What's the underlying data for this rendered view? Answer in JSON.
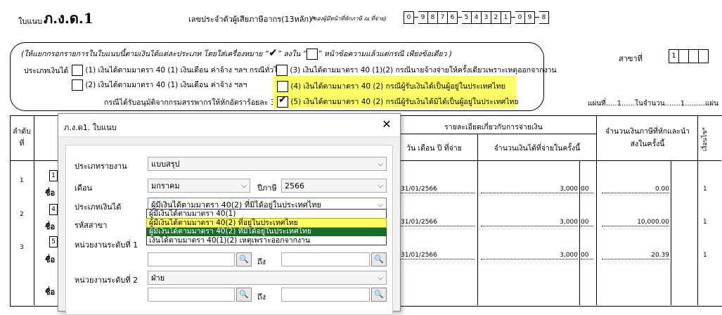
{
  "form": {
    "title_prefix": "ใบแนบ",
    "title": "ภ.ง.ด.1",
    "taxid_label": "เลขประจำตัวผู้เสียภาษีอากร(13หลัก)*",
    "taxid_note": "(ของผู้มีหน้าที่หักภาษี ณ ที่จ่าย)",
    "taxid_digits": [
      "0",
      "9",
      "8",
      "7",
      "6",
      "5",
      "4",
      "3",
      "2",
      "1",
      "0",
      "9",
      "8"
    ],
    "instruction": "(ให้แยกกรอกรายการในใบแนบนี้ตามเงินได้แต่ละประเภท โดยใส่เครื่องหมาย “",
    "instruction_mid": "” ลงใน “",
    "instruction_end": "” หน้าข้อความแล้วแต่กรณี เพียงข้อเดียว )",
    "check_mark": "✔",
    "income_type_label": "ประเภทเงินได้",
    "options": [
      "(1) เงินได้ตามมาตรา 40 (1) เงินเดือน ค่าจ้าง ฯลฯ กรณีทั่วไป",
      "(2) เงินได้ตามมาตรา 40 (1) เงินเดือน ค่าจ้าง ฯลฯ",
      "(3) เงินได้ตามมาตรา 40 (1)(2) กรณีนายจ้างจ่ายให้ครั้งเดียวเพราะเหตุออกจากงาน",
      "(4) เงินได้ตามมาตรา 40 (2) กรณีผู้รับเงินได้เป็นผู้อยู่ในประเทศไทย",
      "(5) เงินได้ตามมาตรา 40 (2) กรณีผู้รับเงินได้มิได้เป็นผู้อยู่ในประเทศไทย"
    ],
    "option2_sub": "กรณีได้รับอนุมัติจากกรมสรรพากรให้หักอัตราร้อยละ 3",
    "branch_label": "สาขาที่",
    "branch_digits": [
      "1",
      "",
      "",
      ""
    ],
    "sheet_text": "แผ่นที่.....1......ในจำนวน.......1.........แผ่น"
  },
  "table": {
    "col_seq": "ลำดับที่",
    "col_payment_group": "รายละเอียดเกี่ยวกับการจ่ายเงิน",
    "col_date": "วัน เดือน ปี ที่จ่าย",
    "col_amount": "จำนวนเงินได้ที่จ่ายในครั้งนี้",
    "col_tax": "จำนวนเงินภาษีที่หักและนำส่งในครั้งนี้",
    "col_cond": "เงื่อนไข*",
    "row_seq": [
      "1",
      "2",
      "3"
    ],
    "row_index": [
      "1",
      "4",
      "5"
    ],
    "name_label": "ชื่อ",
    "rows": [
      {
        "date": "31/01/2566",
        "amount": "3,000",
        "amount_dec": "00",
        "tax": "0.00",
        "cond": "1"
      },
      {
        "date": "31/01/2566",
        "amount": "3,000",
        "amount_dec": "00",
        "tax": "10,000.00",
        "cond": "1"
      },
      {
        "date": "31/01/2566",
        "amount": "3,000",
        "amount_dec": "00",
        "tax": "20.39",
        "cond": "1"
      }
    ]
  },
  "dialog": {
    "title": "ภ.ง.ด1. ใบแนบ",
    "close_glyph": "✕",
    "report_type_label": "ประเภทรายงาน",
    "report_type_value": "แบบสรุป",
    "month_label": "เดือน",
    "month_value": "มกราคม",
    "year_label": "ปีภาษี",
    "year_value": "2566",
    "income_type_label": "ประเภทเงินได้",
    "income_type_value": "ผู้มีเงินได้ตามมาตรา 40(2) ที่มิได้อยู่ในประเทศไทย",
    "branch_label": "รหัสสาขา",
    "unit1_label": "หน่วยงานระดับที่ 1",
    "unit2_label": "หน่วยงานระดับที่ 2",
    "unit2_value": "ฝ่าย",
    "to_label": "ถึง",
    "lookup_glyph": "🔍",
    "arrow_glyph": "⌵",
    "dropdown_options": [
      "ผู้มีเงินได้ตามมาตรา 40(1)",
      "ผู้มีเงินได้ตามมาตรา 40(2) ที่อยู่ในประเทศไทย",
      "ผู้มีเงินได้ตามมาตรา 40(2) ที่มิได้อยู่ในประเทศไทย",
      "เงินได้ตามมาตรา 40(1)(2) เหตุเพราะออกจากงาน"
    ]
  },
  "colors": {
    "highlight": "#ffff66",
    "selected": "#1b6b2b"
  }
}
